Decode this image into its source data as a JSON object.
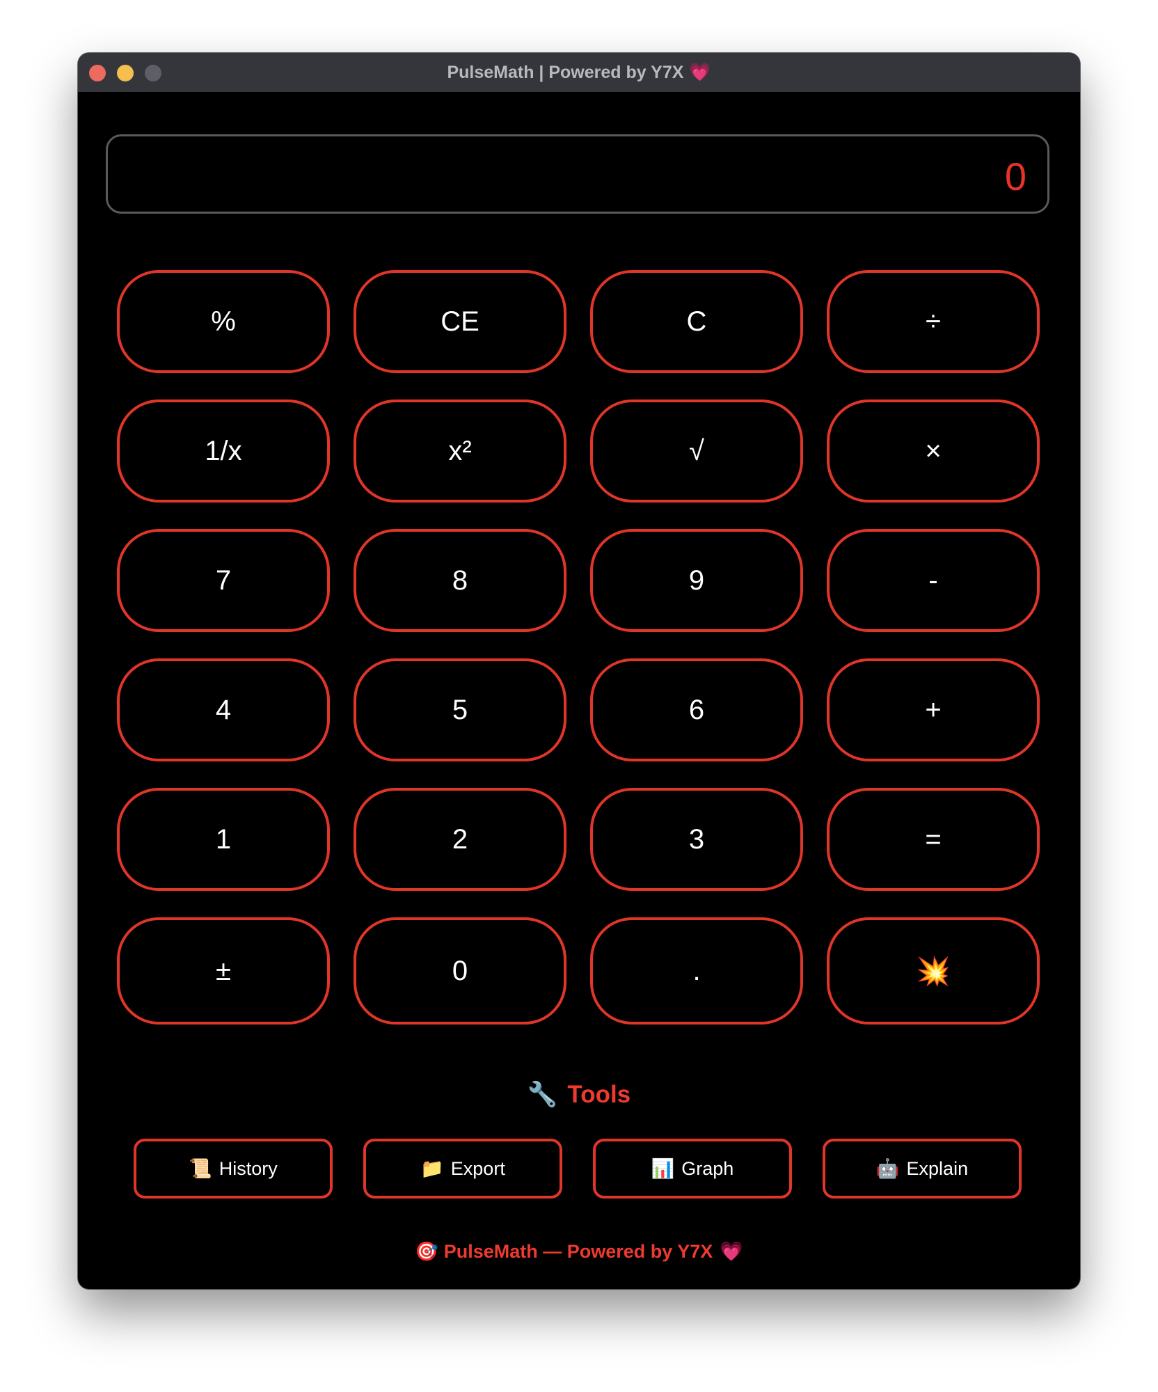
{
  "window": {
    "title": "PulseMath | Powered by Y7X",
    "title_emoji": "💗"
  },
  "display": {
    "value": "0"
  },
  "keypad": {
    "keys": [
      "%",
      "CE",
      "C",
      "÷",
      "1/x",
      "x²",
      "√",
      "×",
      "7",
      "8",
      "9",
      "-",
      "4",
      "5",
      "6",
      "+",
      "1",
      "2",
      "3",
      "=",
      "±",
      "0",
      ".",
      "💥"
    ]
  },
  "tools": {
    "icon": "🔧",
    "title": "Tools",
    "buttons": [
      {
        "icon": "📜",
        "label": "History"
      },
      {
        "icon": "📁",
        "label": "Export"
      },
      {
        "icon": "📊",
        "label": "Graph"
      },
      {
        "icon": "🤖",
        "label": "Explain"
      }
    ]
  },
  "footer": {
    "icon": "🎯",
    "text": "PulseMath — Powered by Y7X",
    "emoji": "💗"
  },
  "colors": {
    "accent": "#e03529",
    "background": "#000000",
    "titlebar": "#35353c",
    "display_border": "#5a5a5a",
    "display_text": "#e8332a"
  }
}
